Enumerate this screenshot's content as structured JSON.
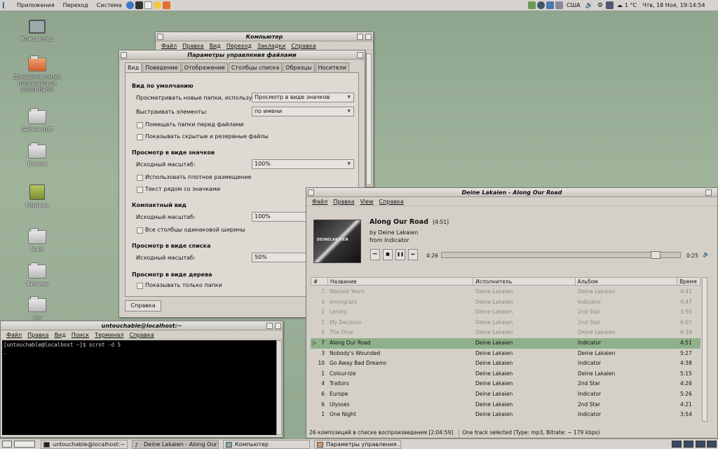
{
  "top_panel": {
    "menus": [
      "Приложения",
      "Переход",
      "Система"
    ],
    "tray_text": [
      "США"
    ],
    "temperature": "1 °C",
    "clock": "Чтв, 18 Ноя, 19:14:54"
  },
  "desktop": {
    "icons": [
      {
        "label": "Компьютер"
      },
      {
        "label": "Домашняя папка пользователя untouchable"
      },
      {
        "label": "Gabe's stuff"
      },
      {
        "label": "Всякое"
      },
      {
        "label": "Корзина"
      },
      {
        "label": "Math"
      },
      {
        "label": "Фильмы"
      },
      {
        "label": "kss"
      }
    ]
  },
  "computer_window": {
    "title": "Компьютер",
    "menu": [
      "Файл",
      "Правка",
      "Вид",
      "Переход",
      "Закладки",
      "Справка"
    ]
  },
  "prefs_dialog": {
    "title": "Параметры управления файлами",
    "tabs": [
      "Вид",
      "Поведение",
      "Отображение",
      "Столбцы списка",
      "Образцы",
      "Носители"
    ],
    "section_default": "Вид по умолчанию",
    "view_new_folders_label": "Просматривать новые папки, используя:",
    "view_new_folders_value": "Просмотр в виде значков",
    "arrange_label": "Выстраивать элементы:",
    "arrange_value": "по имени",
    "folders_first": "Помещать папки перед файлами",
    "show_hidden": "Показывать скрытые и резервные файлы",
    "section_icon_view": "Просмотр в виде значков",
    "icon_zoom_label": "Исходный масштаб:",
    "icon_zoom_value": "100%",
    "compact_layout": "Использовать плотное размещение",
    "text_beside": "Текст рядом со значками",
    "section_compact": "Компактный вид",
    "compact_zoom_label": "Исходный масштаб:",
    "compact_zoom_value": "100%",
    "same_width": "Все столбцы одинаковой ширины",
    "section_list": "Просмотр в виде списка",
    "list_zoom_label": "Исходный масштаб:",
    "list_zoom_value": "50%",
    "section_tree": "Просмотр в виде дерева",
    "only_folders": "Показывать только папки",
    "help_button": "Справка"
  },
  "terminal": {
    "title": "untouchable@localhost:~",
    "menu": [
      "Файл",
      "Правка",
      "Вид",
      "Поиск",
      "Терминал",
      "Справка"
    ],
    "line1": "[untouchable@localhost ~]$ scrot -d 5",
    "cursor": "_"
  },
  "player": {
    "title": "Deine Lakaien - Along Our Road",
    "menu": [
      "Файл",
      "Правка",
      "View",
      "Справка"
    ],
    "album_art_text": "DEINELAKAIEN",
    "now_title": "Along Our Road",
    "now_length": "[4:51]",
    "now_artist": "by Deine Lakaien",
    "now_album": "from Indicator",
    "elapsed": "4:26",
    "remaining": "0:25",
    "progress_fraction": 0.91,
    "columns": [
      "#",
      "Название",
      "Исполнитель",
      "Альбом",
      "Время"
    ],
    "tracks": [
      {
        "n": "7",
        "title": "Wasted Years",
        "artist": "Deine Lakaien",
        "album": "Deine Lakaien",
        "time": "4:41",
        "state": "dim"
      },
      {
        "n": "4",
        "title": "Immigrant",
        "artist": "Deine Lakaien",
        "album": "Indicator",
        "time": "4:47",
        "state": "dim"
      },
      {
        "n": "2",
        "title": "Lonley",
        "artist": "Deine Lakaien",
        "album": "2nd Star",
        "time": "3:50",
        "state": "dim"
      },
      {
        "n": "1",
        "title": "My Decision",
        "artist": "Deine Lakaien",
        "album": "2nd Star",
        "time": "6:07",
        "state": "dim"
      },
      {
        "n": "5",
        "title": "The Dive",
        "artist": "Deine Lakaien",
        "album": "Deine Lakaien",
        "time": "6:39",
        "state": "dim"
      },
      {
        "n": "7",
        "title": "Along Our Road",
        "artist": "Deine Lakaien",
        "album": "Indicator",
        "time": "4:51",
        "state": "playing"
      },
      {
        "n": "3",
        "title": "Nobody's Wounded",
        "artist": "Deine Lakaien",
        "album": "Deine Lakaien",
        "time": "5:27",
        "state": ""
      },
      {
        "n": "10",
        "title": "Go Away Bad Dreams",
        "artist": "Deine Lakaien",
        "album": "Indicator",
        "time": "4:38",
        "state": ""
      },
      {
        "n": "1",
        "title": "Colour-Ize",
        "artist": "Deine Lakaien",
        "album": "Deine Lakaien",
        "time": "5:15",
        "state": ""
      },
      {
        "n": "4",
        "title": "Traitors",
        "artist": "Deine Lakaien",
        "album": "2nd Star",
        "time": "4:26",
        "state": ""
      },
      {
        "n": "6",
        "title": "Europe",
        "artist": "Deine Lakaien",
        "album": "Indicator",
        "time": "5:26",
        "state": ""
      },
      {
        "n": "6",
        "title": "Ulysses",
        "artist": "Deine Lakaien",
        "album": "2nd Star",
        "time": "4:21",
        "state": ""
      },
      {
        "n": "1",
        "title": "One Night",
        "artist": "Deine Lakaien",
        "album": "Indicator",
        "time": "3:54",
        "state": ""
      }
    ],
    "status_left": "26 композиций в списке воспроизведения [2:04:59]",
    "status_right": "One track selected (Type: mp3, Bitrate: ~ 179 kbps)"
  },
  "taskbar": {
    "tasks": [
      {
        "label": "untouchable@localhost:~"
      },
      {
        "label": "Deine Lakaien - Along Our Road"
      },
      {
        "label": "Компьютер"
      },
      {
        "label": "Параметры управления ..."
      }
    ]
  },
  "colors": {
    "desktop_green": "#93a890",
    "selected_row": "#8fb08a",
    "window_bg": "#d4d0c8"
  }
}
